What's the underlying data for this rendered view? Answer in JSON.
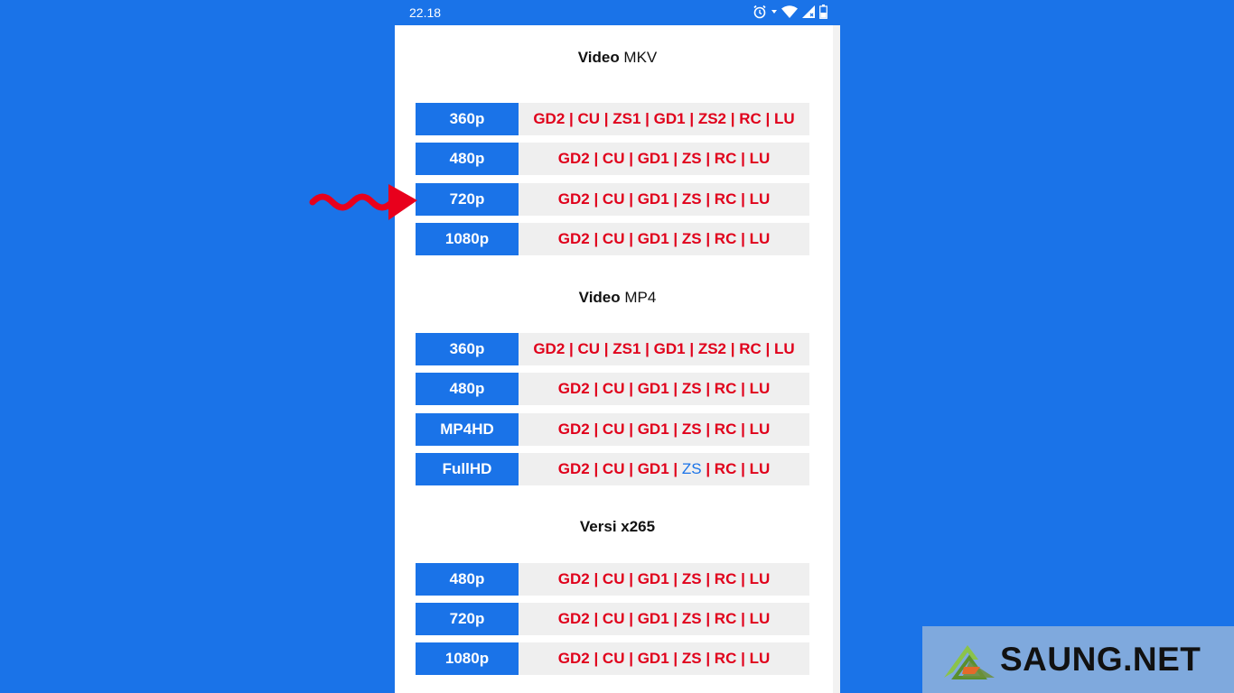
{
  "status_bar": {
    "time": "22.18",
    "icons": [
      "alarm-icon",
      "wifi-icon",
      "signal-icon",
      "battery-icon"
    ]
  },
  "sections": [
    {
      "title_bold": "Video",
      "title_rest": " MKV",
      "rows": [
        {
          "resolution": "360p",
          "links": [
            "GD2",
            "CU",
            "ZS1",
            "GD1",
            "ZS2",
            "RC",
            "LU"
          ]
        },
        {
          "resolution": "480p",
          "links": [
            "GD2",
            "CU",
            "GD1",
            "ZS",
            "RC",
            "LU"
          ]
        },
        {
          "resolution": "720p",
          "links": [
            "GD2",
            "CU",
            "GD1",
            "ZS",
            "RC",
            "LU"
          ]
        },
        {
          "resolution": "1080p",
          "links": [
            "GD2",
            "CU",
            "GD1",
            "ZS",
            "RC",
            "LU"
          ]
        }
      ]
    },
    {
      "title_bold": "Video",
      "title_rest": " MP4",
      "rows": [
        {
          "resolution": "360p",
          "links": [
            "GD2",
            "CU",
            "ZS1",
            "GD1",
            "ZS2",
            "RC",
            "LU"
          ]
        },
        {
          "resolution": "480p",
          "links": [
            "GD2",
            "CU",
            "GD1",
            "ZS",
            "RC",
            "LU"
          ]
        },
        {
          "resolution": "MP4HD",
          "links": [
            "GD2",
            "CU",
            "GD1",
            "ZS",
            "RC",
            "LU"
          ]
        },
        {
          "resolution": "FullHD",
          "links": [
            "GD2",
            "CU",
            "GD1",
            "ZS",
            "RC",
            "LU"
          ],
          "visited_link": "ZS"
        }
      ]
    },
    {
      "title_bold": "Versi x265",
      "title_rest": "",
      "rows": [
        {
          "resolution": "480p",
          "links": [
            "GD2",
            "CU",
            "GD1",
            "ZS",
            "RC",
            "LU"
          ]
        },
        {
          "resolution": "720p",
          "links": [
            "GD2",
            "CU",
            "GD1",
            "ZS",
            "RC",
            "LU"
          ]
        },
        {
          "resolution": "1080p",
          "links": [
            "GD2",
            "CU",
            "GD1",
            "ZS",
            "RC",
            "LU"
          ]
        }
      ]
    }
  ],
  "link_separator": " | ",
  "annotation": {
    "icon": "red-arrow-icon",
    "points_to": "720p",
    "color": "#e8001c"
  },
  "watermark": {
    "text": "SAUNG.NET",
    "icon": "saung-logo-icon"
  },
  "colors": {
    "background": "#1a73e8",
    "resolution_button": "#1a73e8",
    "link_text": "#e0001b",
    "visited_link": "#1a73e8",
    "link_cell": "#efefef"
  }
}
